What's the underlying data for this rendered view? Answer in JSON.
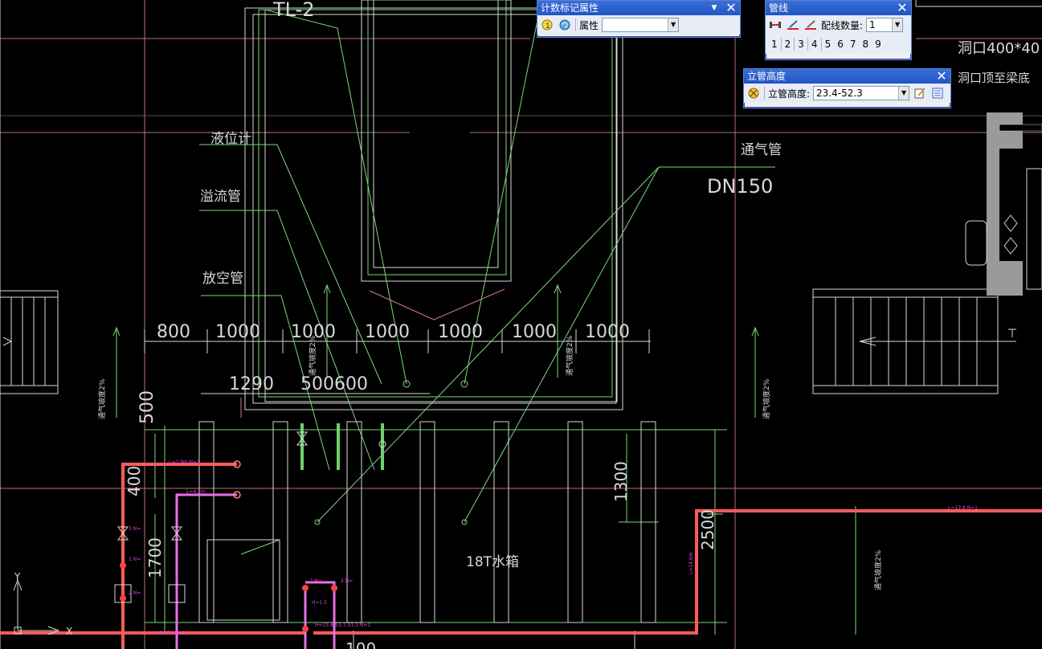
{
  "cad": {
    "labels": {
      "tl2": "TL-2",
      "level_gauge": "液位计",
      "overflow_pipe": "溢流管",
      "vent_pipe": "放空管",
      "breather_pipe": "通气管",
      "dn150": "DN150",
      "hole_size": "洞口400*40",
      "hole_top": "洞口顶至梁底",
      "tank": "18T水箱",
      "dim_500": "500",
      "dim_400": "400",
      "dim_1700": "1700",
      "dim_1300": "1300",
      "dim_2500": "2500",
      "dim_1290": "1290",
      "dim_500600": "500600",
      "dim_bottom": "100",
      "slope_label": "通气坡度2%",
      "axis_y": "Y",
      "axis_x": "X"
    },
    "top_dims": [
      "800",
      "1000",
      "1000",
      "1000",
      "1000",
      "1000",
      "1000"
    ]
  },
  "toolbars": {
    "count_mark": {
      "title": "计数标记属性",
      "dropdown_glyph": "▼",
      "close_glyph": "✕",
      "attr_label": "属性",
      "attr_value": "",
      "icon1": "info-badge-icon",
      "icon2": "refresh-icon"
    },
    "pipeline": {
      "title": "管线",
      "close_glyph": "✕",
      "wire_count_label": "配线数量:",
      "wire_count_value": "1",
      "numbers": [
        "1",
        "2",
        "3",
        "4",
        "5",
        "6",
        "7",
        "8",
        "9"
      ],
      "icons": [
        "pipe-line-icon",
        "pipe-pencil-icon",
        "pipe-edit-icon"
      ]
    },
    "riser_height": {
      "title": "立管高度",
      "close_glyph": "✕",
      "label": "立管高度:",
      "value": "23.4-52.3",
      "icons": [
        "riser-target-icon",
        "edit-note-icon",
        "list-icon"
      ]
    }
  },
  "colors": {
    "background": "#000000",
    "green": "#7ed87e",
    "white": "#d8d8d8",
    "pink_line": "#c77a86",
    "red_pipe": "#ff5252",
    "magenta": "#e040e0",
    "toolbar_title": "#2a5cc8"
  }
}
